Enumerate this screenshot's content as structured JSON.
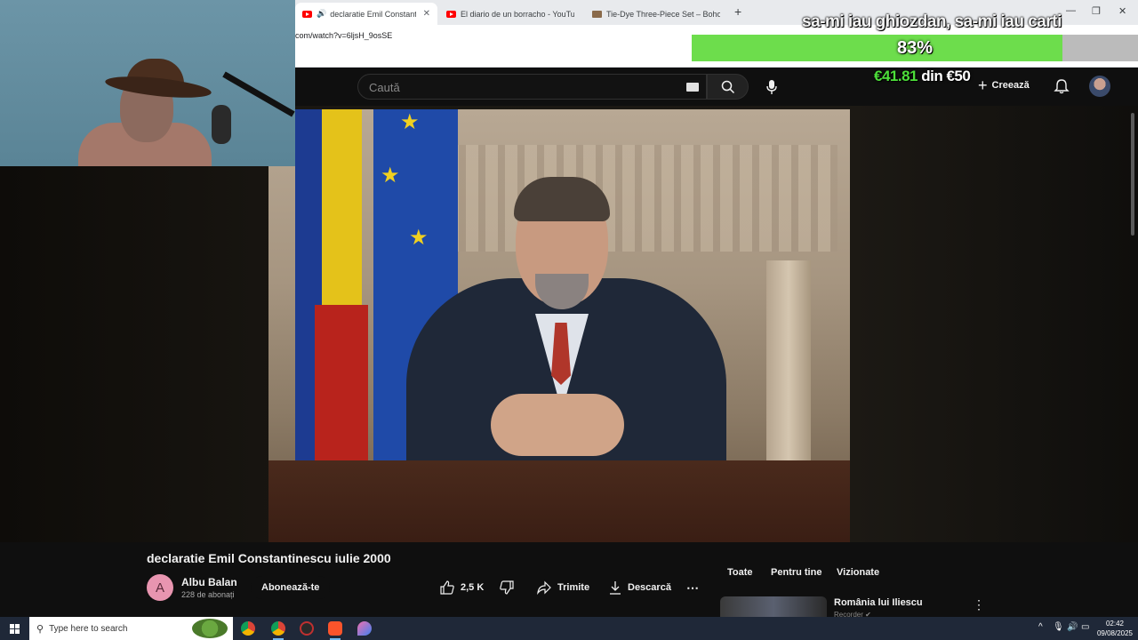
{
  "browser": {
    "tabs": [
      {
        "title": "declaratie Emil Constantinescu",
        "active": true,
        "audio": true,
        "icon": "youtube-icon"
      },
      {
        "title": "El diario de un borracho - YouTube",
        "active": false,
        "icon": "youtube-icon"
      },
      {
        "title": "Tie-Dye Three-Piece Set – Boho Chic",
        "active": false,
        "icon": "shop-icon"
      }
    ],
    "new_tab": "+",
    "window_controls": {
      "minimize": "—",
      "restore": "❐",
      "close": "✕"
    },
    "url": "com/watch?v=6ljsH_9osSE"
  },
  "stream_overlay": {
    "caption": "sa-mi iau ghiozdan, sa-mi iau carti",
    "progress_percent": 83,
    "progress_label": "83%",
    "goal_raised": "€41.81",
    "goal_text": " din €50",
    "progress_color": "#6ddd4c"
  },
  "youtube": {
    "search_placeholder": "Caută",
    "create_label": "Creează",
    "video": {
      "title": "declaratie Emil Constantinescu iulie 2000",
      "channel_initial": "A",
      "channel_name": "Albu Balan",
      "subscribers": "228 de abonați",
      "subscribe_label": "Abonează-te",
      "likes": "2,5 K",
      "share_label": "Trimite",
      "download_label": "Descarcă",
      "more_label": "⋯"
    },
    "chips": [
      "Toate",
      "Pentru tine",
      "Vizionate"
    ],
    "recommendation": {
      "title": "România lui Iliescu",
      "subtitle": "Recorder ✔"
    }
  },
  "taskbar": {
    "search_placeholder": "Type here to search",
    "time": "02:42",
    "date": "09/08/2025"
  }
}
